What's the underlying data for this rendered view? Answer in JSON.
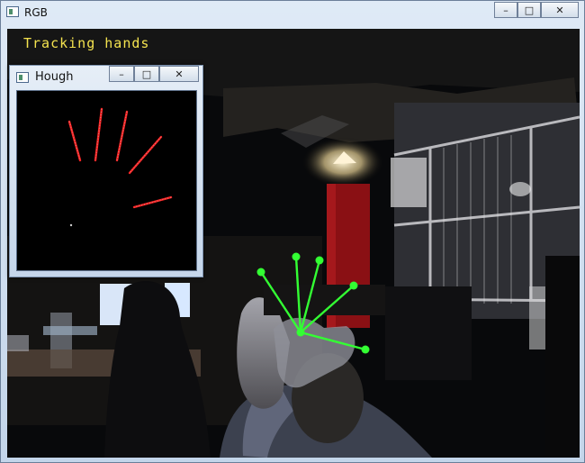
{
  "main_window": {
    "title": "RGB",
    "icon": "opencv-window-icon",
    "buttons": {
      "minimize": "–",
      "maximize": "□",
      "close": "✕"
    }
  },
  "overlay": {
    "status": "Tracking hands"
  },
  "hough_window": {
    "title": "Hough",
    "icon": "opencv-window-icon",
    "buttons": {
      "minimize": "–",
      "maximize": "□",
      "close": "✕"
    }
  },
  "colors": {
    "tracking_line": "#33ff33",
    "hough_line": "#ff2a2a",
    "overlay_text": "#f4e34f"
  }
}
